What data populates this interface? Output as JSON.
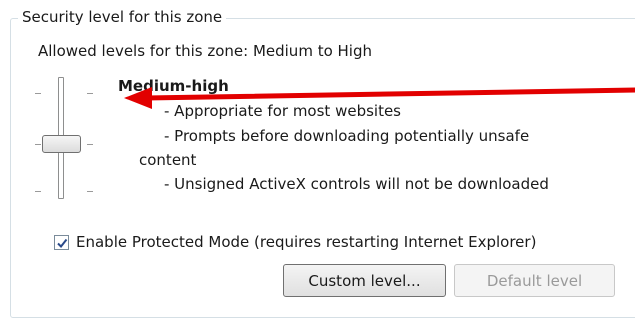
{
  "security_group": {
    "title": "Security level for this zone",
    "allowed_levels": "Allowed levels for this zone: Medium to High"
  },
  "slider": {
    "current_level": "Medium-high",
    "descriptions": [
      "- Appropriate for most websites",
      "- Prompts before downloading potentially unsafe",
      "content",
      "- Unsigned ActiveX controls will not be downloaded"
    ]
  },
  "protected_mode": {
    "label": "Enable Protected Mode (requires restarting Internet Explorer)",
    "checked": true
  },
  "buttons": {
    "custom_level": "Custom level...",
    "default_level": "Default level"
  },
  "annotation": {
    "arrow_color": "#e20000",
    "arrow_icon": "red-arrow-left-icon"
  }
}
